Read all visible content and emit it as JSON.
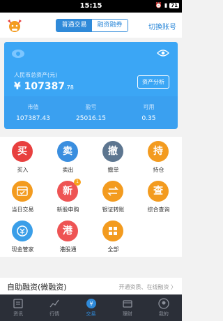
{
  "status": {
    "time": "15:15",
    "battery": "71"
  },
  "header": {
    "tab_trade": "普通交易",
    "tab_margin": "融资融券",
    "switch_account": "切换账号"
  },
  "asset": {
    "label": "人民币总资产(元)",
    "amount_main": "¥ 107387",
    "amount_dec": ".78",
    "analyze": "资产分析",
    "stats": [
      {
        "key": "市值",
        "value": "107387.43"
      },
      {
        "key": "盈亏",
        "value": "25016.15"
      },
      {
        "key": "可用",
        "value": "0.35"
      }
    ]
  },
  "grid": [
    {
      "glyph": "买",
      "label": "买入",
      "color": "#e8403f"
    },
    {
      "glyph": "卖",
      "label": "卖出",
      "color": "#3a8edf"
    },
    {
      "glyph": "撤",
      "label": "撤单",
      "color": "#5d7690"
    },
    {
      "glyph": "持",
      "label": "持仓",
      "color": "#f39b1f"
    },
    {
      "glyph": "",
      "label": "当日交易",
      "color": "#f39b1f"
    },
    {
      "glyph": "新",
      "label": "新股申购",
      "color": "#ee5454",
      "badge": "1"
    },
    {
      "glyph": "",
      "label": "银证转账",
      "color": "#f39b1f"
    },
    {
      "glyph": "查",
      "label": "综合查询",
      "color": "#f39b1f"
    },
    {
      "glyph": "",
      "label": "现金管家",
      "color": "#3a9ee8"
    },
    {
      "glyph": "港",
      "label": "港股通",
      "color": "#ee5454"
    },
    {
      "glyph": "",
      "label": "全部",
      "color": "#f39b1f"
    }
  ],
  "micro": {
    "title": "自助融资(微融资)",
    "right": "开通资质、在线融资 〉"
  },
  "nav": [
    {
      "label": "资讯"
    },
    {
      "label": "行情"
    },
    {
      "label": "交易"
    },
    {
      "label": "理财"
    },
    {
      "label": "我的"
    }
  ]
}
